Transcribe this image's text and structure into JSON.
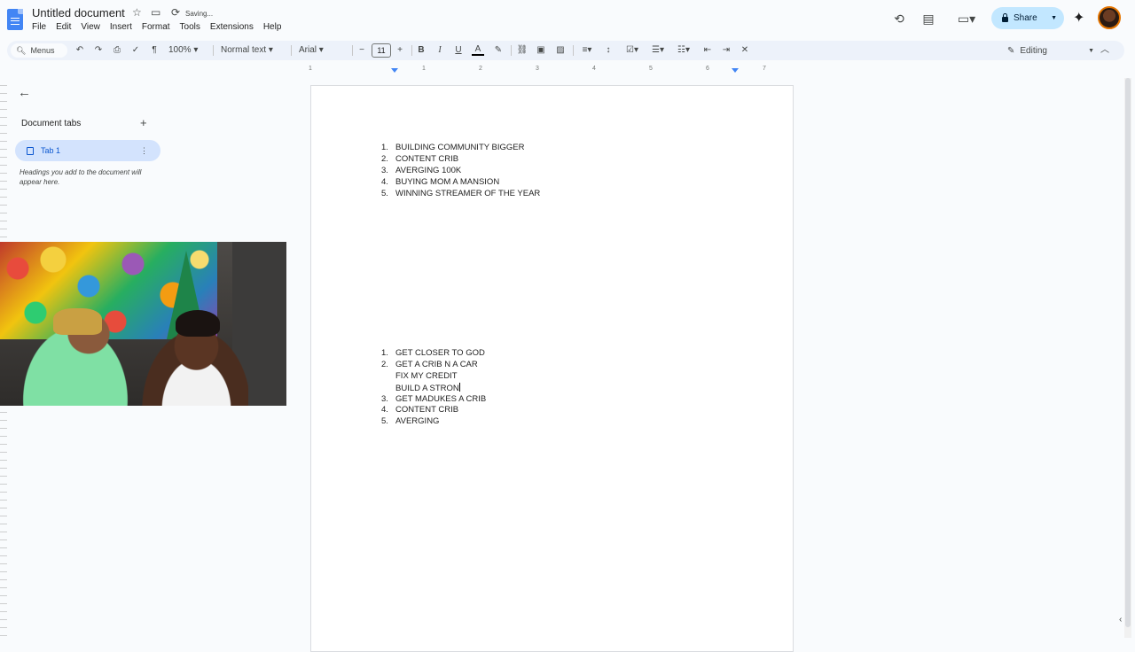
{
  "header": {
    "title": "Untitled document",
    "status": "Saving...",
    "menu": [
      "File",
      "Edit",
      "View",
      "Insert",
      "Format",
      "Tools",
      "Extensions",
      "Help"
    ],
    "share_label": "Share"
  },
  "toolbar": {
    "menus_label": "Menus",
    "zoom": "100%",
    "style": "Normal text",
    "font": "Arial",
    "font_size": "11",
    "mode": "Editing"
  },
  "ruler": {
    "numbers": [
      "1",
      "1",
      "2",
      "3",
      "4",
      "5",
      "6",
      "7"
    ]
  },
  "sidebar": {
    "tabs_title": "Document tabs",
    "tab_label": "Tab 1",
    "hint": "Headings you add to the document will appear here."
  },
  "document": {
    "list1": [
      {
        "num": "1.",
        "text": "BUILDING COMMUNITY BIGGER"
      },
      {
        "num": "2.",
        "text": "CONTENT CRIB"
      },
      {
        "num": "3.",
        "text": "AVERGING 100K"
      },
      {
        "num": "4.",
        "text": "BUYING MOM A MANSION"
      },
      {
        "num": "5.",
        "text": "WINNING STREAMER OF THE YEAR"
      }
    ],
    "list2": [
      {
        "num": "1.",
        "text": "GET CLOSER TO GOD"
      },
      {
        "num": "2.",
        "text": "GET A CRIB N A CAR"
      },
      {
        "num": "",
        "text": "FIX MY CREDIT"
      },
      {
        "num": "",
        "text": "BUILD A STRON"
      },
      {
        "num": "3.",
        "text": "GET MADUKES A CRIB"
      },
      {
        "num": "4.",
        "text": "CONTENT CRIB"
      },
      {
        "num": "5.",
        "text": "AVERGING"
      }
    ]
  },
  "colors": {
    "accent": "#0b57d0",
    "share_bg": "#c2e7ff",
    "tab_bg": "#d3e3fd"
  }
}
